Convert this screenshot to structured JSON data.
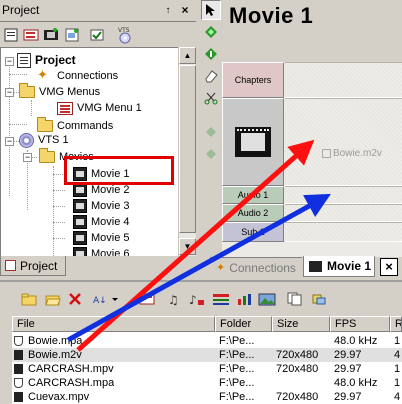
{
  "project_panel": {
    "title": "Project",
    "pin_glyph": "↑",
    "close_glyph": "×",
    "toolbar_icons": [
      "new-project-icon",
      "new-menu-icon",
      "new-movie-icon",
      "new-slideshow-icon",
      "properties-icon",
      "vts-icon"
    ],
    "vts_toolbar_label": "VTS",
    "tree": {
      "root": "Project",
      "connections": "Connections",
      "vmg_menus": "VMG Menus",
      "vmg_menu_1": "VMG Menu 1",
      "commands": "Commands",
      "vts_1": "VTS 1",
      "movies": "Movies",
      "movie_items": [
        "Movie 1",
        "Movie 2",
        "Movie 3",
        "Movie 4",
        "Movie 5",
        "Movie 6"
      ]
    },
    "tab_label": "Project"
  },
  "tool_strip": {
    "tools": [
      "arrow-icon",
      "add-chapter-icon",
      "add-cell-icon",
      "eraser-icon",
      "cut-icon",
      "move-icon",
      "nudge-icon"
    ]
  },
  "movie_editor": {
    "title": "Movie 1",
    "tracks": {
      "chapters": "Chapters",
      "audio_1": "Audio 1",
      "audio_2": "Audio 2",
      "subtitle_1": "Sub 1"
    },
    "clip_label": "Bowie.m2v"
  },
  "editor_tabs": {
    "connections": "Connections",
    "movie_1": "Movie 1",
    "close_glyph": "×"
  },
  "files_panel": {
    "columns": [
      "File",
      "Folder",
      "Size",
      "FPS",
      "R"
    ],
    "rows": [
      {
        "type": "audio",
        "file": "Bowie.mpa",
        "folder": "F:\\Pe...",
        "size": "",
        "fps": "48.0 kHz",
        "rate": "1"
      },
      {
        "type": "video",
        "file": "Bowie.m2v",
        "folder": "F:\\Pe...",
        "size": "720x480",
        "fps": "29.97",
        "rate": "4"
      },
      {
        "type": "video",
        "file": "CARCRASH.mpv",
        "folder": "F:\\Pe...",
        "size": "720x480",
        "fps": "29.97",
        "rate": "1"
      },
      {
        "type": "audio",
        "file": "CARCRASH.mpa",
        "folder": "F:\\Pe...",
        "size": "",
        "fps": "48.0 kHz",
        "rate": "1"
      },
      {
        "type": "video",
        "file": "Cuevax.mpv",
        "folder": "F:\\Pe...",
        "size": "720x480",
        "fps": "29.97",
        "rate": "4"
      }
    ],
    "selected_row": "Bowie.m2v"
  },
  "annotation": {
    "highlight_color": "#e00000",
    "red_arrow_color": "#ff1010",
    "blue_arrow_color": "#1030e0"
  }
}
